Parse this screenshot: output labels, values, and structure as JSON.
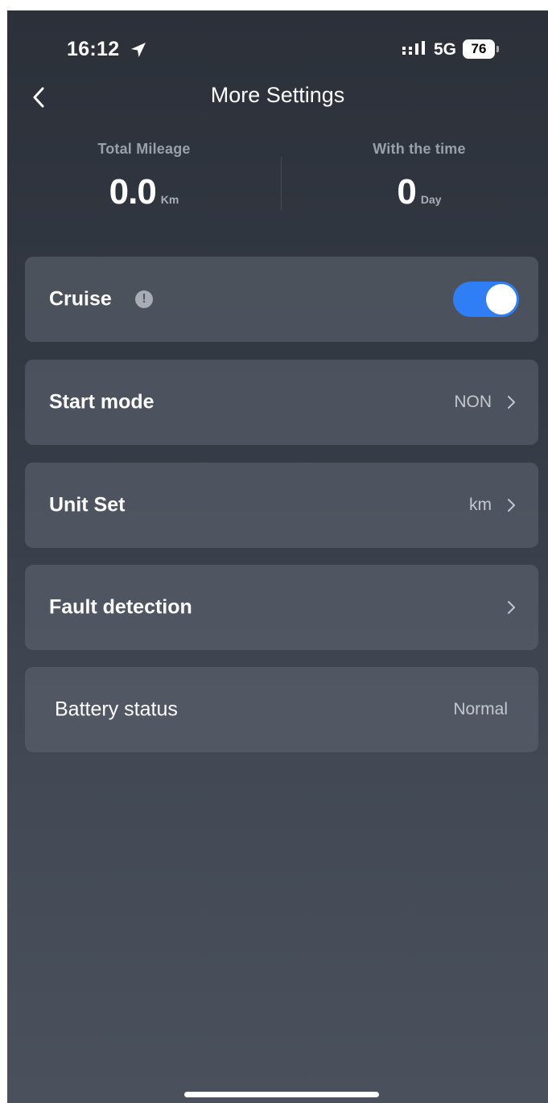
{
  "status_bar": {
    "time": "16:12",
    "network": "5G",
    "battery": "76"
  },
  "header": {
    "title": "More Settings"
  },
  "stats": {
    "total_mileage": {
      "label": "Total Mileage",
      "value": "0.0",
      "unit": "Km"
    },
    "with_time": {
      "label": "With the time",
      "value": "0",
      "unit": "Day"
    }
  },
  "settings": {
    "cruise": {
      "label": "Cruise",
      "enabled": true
    },
    "start_mode": {
      "label": "Start mode",
      "value": "NON"
    },
    "unit_set": {
      "label": "Unit Set",
      "value": "km"
    },
    "fault_detection": {
      "label": "Fault detection"
    },
    "battery_status": {
      "label": "Battery status",
      "value": "Normal"
    }
  },
  "colors": {
    "toggle_on": "#2f7ef5",
    "background_top": "#2b3039",
    "background_bottom": "#4a515d"
  }
}
